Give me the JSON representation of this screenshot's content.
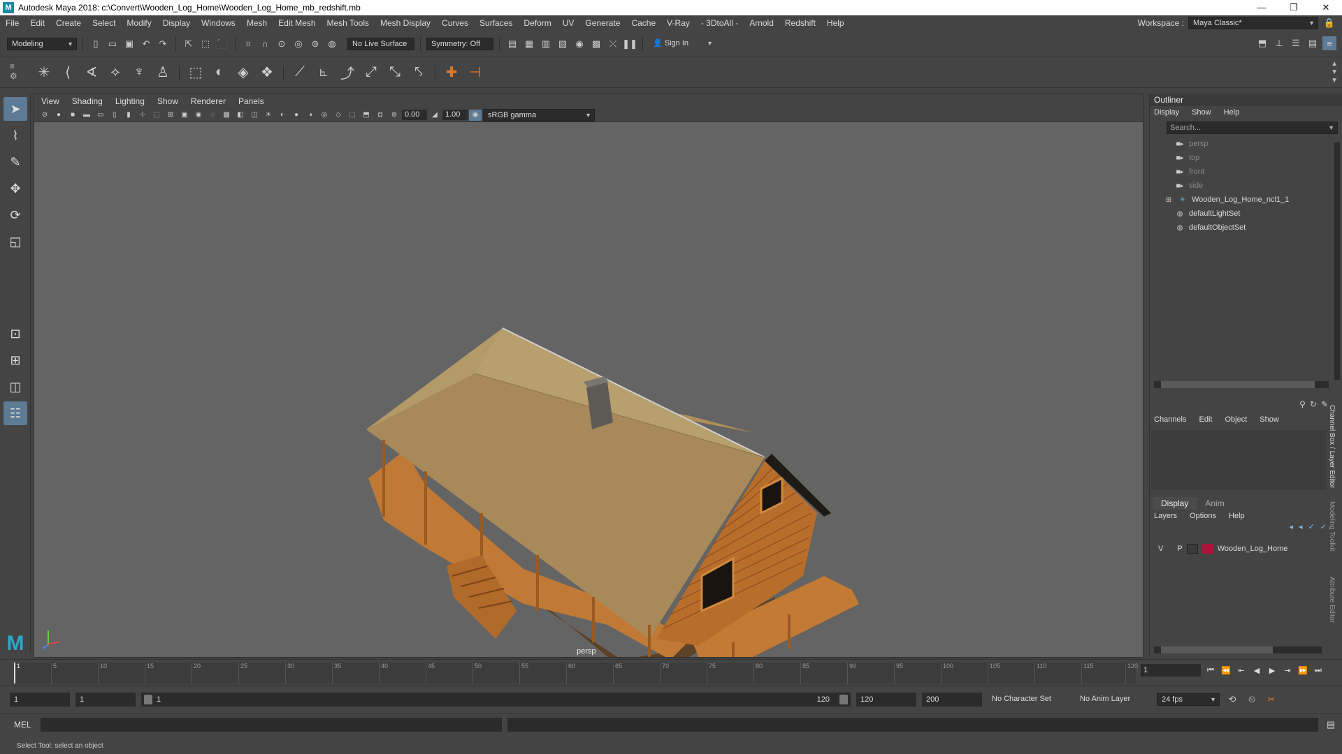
{
  "window": {
    "title": "Autodesk Maya 2018: c:\\Convert\\Wooden_Log_Home\\Wooden_Log_Home_mb_redshift.mb",
    "minimize": "—",
    "maximize": "❐",
    "close": "✕"
  },
  "menubar": {
    "items": [
      "File",
      "Edit",
      "Create",
      "Select",
      "Modify",
      "Display",
      "Windows",
      "Mesh",
      "Edit Mesh",
      "Mesh Tools",
      "Mesh Display",
      "Curves",
      "Surfaces",
      "Deform",
      "UV",
      "Generate",
      "Cache",
      "V-Ray",
      "- 3DtoAll -",
      "Arnold",
      "Redshift",
      "Help"
    ],
    "workspace_label": "Workspace :",
    "workspace_value": "Maya Classic*"
  },
  "statusline": {
    "mode": "Modeling",
    "live_surface": "No Live Surface",
    "symmetry": "Symmetry: Off",
    "sign_in": "Sign In"
  },
  "viewport": {
    "menus": [
      "View",
      "Shading",
      "Lighting",
      "Show",
      "Renderer",
      "Panels"
    ],
    "exposure": "0.00",
    "gamma": "1.00",
    "color_space": "sRGB gamma",
    "camera_label": "persp"
  },
  "outliner": {
    "title": "Outliner",
    "menus": [
      "Display",
      "Show",
      "Help"
    ],
    "search_placeholder": "Search...",
    "items": [
      {
        "label": "persp",
        "icon": "camera-icon"
      },
      {
        "label": "top",
        "icon": "camera-icon"
      },
      {
        "label": "front",
        "icon": "camera-icon"
      },
      {
        "label": "side",
        "icon": "camera-icon"
      },
      {
        "label": "Wooden_Log_Home_ncl1_1",
        "icon": "group-icon"
      },
      {
        "label": "defaultLightSet",
        "icon": "set-icon"
      },
      {
        "label": "defaultObjectSet",
        "icon": "set-icon"
      }
    ]
  },
  "channelbox": {
    "menus": [
      "Channels",
      "Edit",
      "Object",
      "Show"
    ]
  },
  "layers": {
    "tabs": [
      "Display",
      "Anim"
    ],
    "menus": [
      "Layers",
      "Options",
      "Help"
    ],
    "row": {
      "v": "V",
      "p": "P",
      "name": "Wooden_Log_Home",
      "color": "#b0143a"
    }
  },
  "sidetabs": [
    "Channel Box / Layer Editor",
    "Modeling Toolkit",
    "Attribute Editor"
  ],
  "timeline": {
    "ticks": [
      "1",
      "5",
      "10",
      "15",
      "20",
      "25",
      "30",
      "35",
      "40",
      "45",
      "50",
      "55",
      "60",
      "65",
      "70",
      "75",
      "80",
      "85",
      "90",
      "95",
      "100",
      "105",
      "110",
      "115",
      "120"
    ],
    "current_frame": "1"
  },
  "range": {
    "start": "1",
    "anim_start": "1",
    "slider_start": "1",
    "slider_end": "120",
    "anim_end": "120",
    "end": "200",
    "character_set": "No Character Set",
    "anim_layer": "No Anim Layer",
    "fps": "24 fps"
  },
  "cmdline": {
    "lang": "MEL"
  },
  "helpline": {
    "text": "Select Tool: select an object"
  },
  "colors": {
    "accent": "#5d7b95",
    "viewport_bg": "#646464",
    "layer_color": "#b0143a"
  }
}
